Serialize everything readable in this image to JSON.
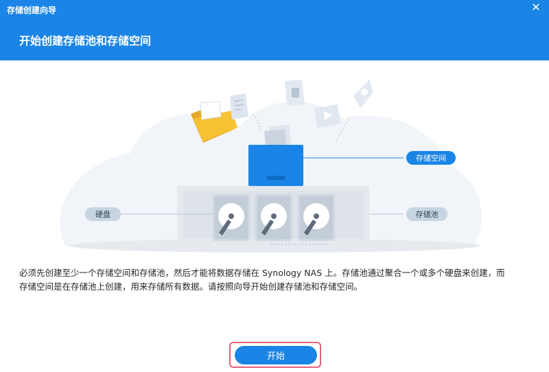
{
  "window": {
    "title": "存储创建向导",
    "close_label": "✕"
  },
  "header": {
    "title": "开始创建存储池和存储空间"
  },
  "illustration": {
    "label_volume": "存储空间",
    "label_disk": "硬盘",
    "label_pool": "存储池"
  },
  "description": {
    "line1": "必须先创建至少一个存储空间和存储池，然后才能将数据存储在 Synology NAS 上。存储池通过聚合一个或多个硬盘来创建，而",
    "line2": "存储空间是在存储池上创建，用来存储所有数据。请按照向导开始创建存储池和存储空间。"
  },
  "actions": {
    "start_label": "开始"
  },
  "colors": {
    "accent": "#1a85e6",
    "highlight_border": "#e2607a",
    "pill_bg": "#c7d5e2"
  }
}
